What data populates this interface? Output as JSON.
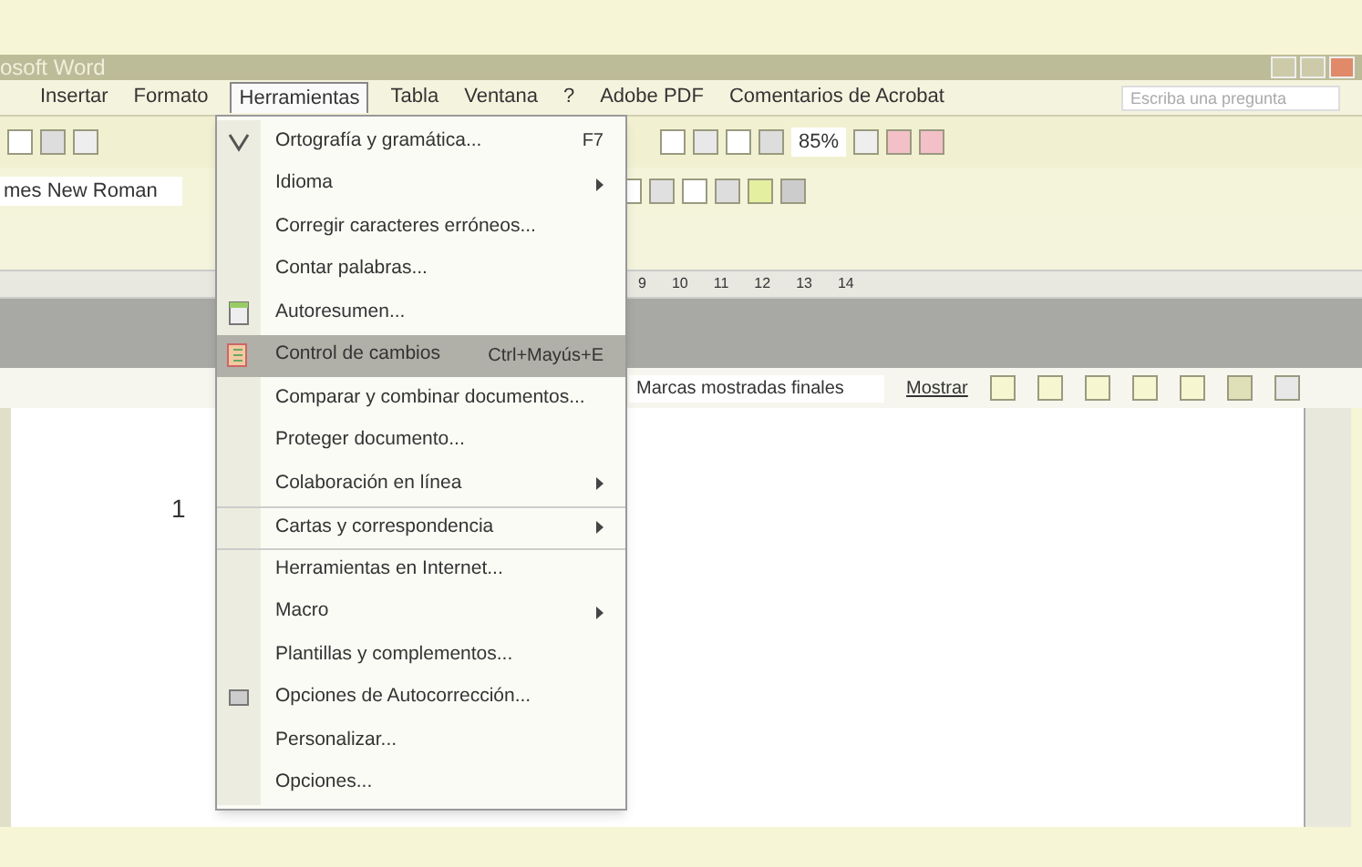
{
  "window": {
    "title": "osoft Word"
  },
  "menubar": [
    {
      "label": "Insertar",
      "selected": false
    },
    {
      "label": "Formato",
      "selected": false
    },
    {
      "label": "Herramientas",
      "selected": true
    },
    {
      "label": "Tabla",
      "selected": false
    },
    {
      "label": "Ventana",
      "selected": false
    },
    {
      "label": "?",
      "selected": false
    },
    {
      "label": "Adobe PDF",
      "selected": false
    },
    {
      "label": "Comentarios de Acrobat",
      "selected": false
    }
  ],
  "help_box": {
    "placeholder": "Escriba una pregunta"
  },
  "formatting": {
    "font": "mes New Roman",
    "zoom": "85%"
  },
  "ruler": [
    "9",
    "10",
    "11",
    "12",
    "13",
    "14"
  ],
  "reviewing": {
    "display": "Marcas mostradas finales",
    "show": "Mostrar"
  },
  "document": {
    "page_number": "1"
  },
  "menu": [
    {
      "label": "Ortografía y gramática...",
      "shortcut": "F7",
      "submenu": false,
      "selected": false,
      "kind": "spell",
      "separator_before": false
    },
    {
      "label": "Idioma",
      "submenu": true,
      "selected": false,
      "separator_before": false
    },
    {
      "label": "Corregir caracteres erróneos...",
      "submenu": false,
      "selected": false,
      "separator_before": false
    },
    {
      "label": "Contar palabras...",
      "submenu": false,
      "selected": false,
      "separator_before": false
    },
    {
      "label": "Autoresumen...",
      "submenu": false,
      "selected": false,
      "kind": "summary",
      "separator_before": false
    },
    {
      "label": "Control de cambios",
      "shortcut": "Ctrl+Mayús+E",
      "submenu": false,
      "selected": true,
      "kind": "track",
      "separator_before": false
    },
    {
      "label": "Comparar y combinar documentos...",
      "submenu": false,
      "selected": false,
      "separator_before": false
    },
    {
      "label": "Proteger documento...",
      "submenu": false,
      "selected": false,
      "separator_before": false
    },
    {
      "label": "Colaboración en línea",
      "submenu": true,
      "selected": false,
      "separator_before": false
    },
    {
      "label": "Cartas y correspondencia",
      "submenu": true,
      "selected": false,
      "separator_before": true
    },
    {
      "label": "Herramientas en Internet...",
      "submenu": false,
      "selected": false,
      "separator_before": true
    },
    {
      "label": "Macro",
      "submenu": true,
      "selected": false,
      "separator_before": false
    },
    {
      "label": "Plantillas y complementos...",
      "submenu": false,
      "selected": false,
      "separator_before": false
    },
    {
      "label": "Opciones de Autocorrección...",
      "submenu": false,
      "selected": false,
      "kind": "autocorrect",
      "separator_before": false
    },
    {
      "label": "Personalizar...",
      "submenu": false,
      "selected": false,
      "separator_before": false
    },
    {
      "label": "Opciones...",
      "submenu": false,
      "selected": false,
      "separator_before": false
    }
  ]
}
